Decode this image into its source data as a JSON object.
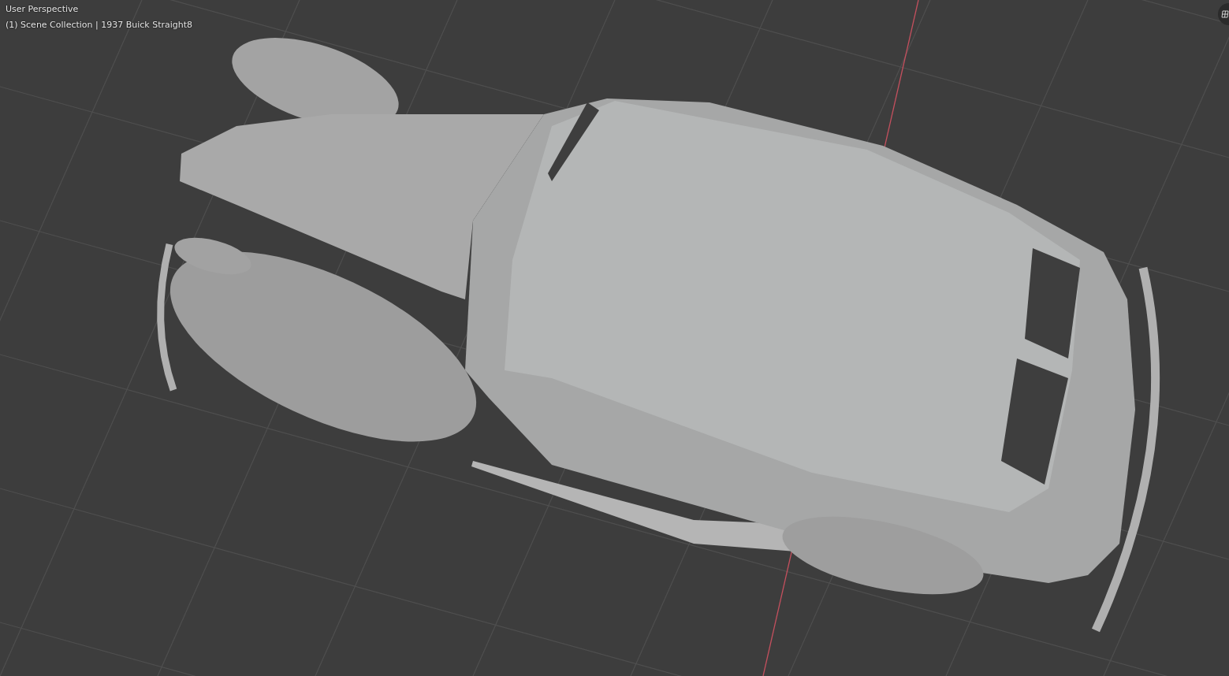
{
  "viewport": {
    "view_name": "User Perspective",
    "collection_info": "(1) Scene Collection | 1937 Buick Straight8"
  }
}
